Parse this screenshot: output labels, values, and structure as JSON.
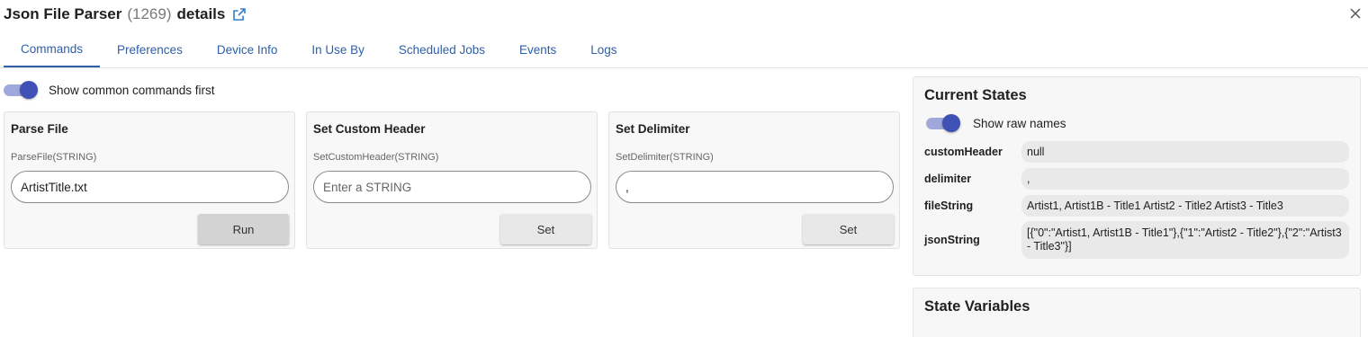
{
  "header": {
    "name": "Json File Parser",
    "id": "(1269)",
    "details": "details",
    "external_icon": "external-link-icon",
    "close_icon": "close-icon"
  },
  "tabs": [
    {
      "label": "Commands",
      "active": true
    },
    {
      "label": "Preferences",
      "active": false
    },
    {
      "label": "Device Info",
      "active": false
    },
    {
      "label": "In Use By",
      "active": false
    },
    {
      "label": "Scheduled Jobs",
      "active": false
    },
    {
      "label": "Events",
      "active": false
    },
    {
      "label": "Logs",
      "active": false
    }
  ],
  "commands": {
    "common_toggle_label": "Show common commands first",
    "common_toggle_on": true,
    "cards": [
      {
        "title": "Parse File",
        "signature": "ParseFile(STRING)",
        "value": "ArtistTitle.txt",
        "placeholder": "Enter a STRING",
        "button": "Run"
      },
      {
        "title": "Set Custom Header",
        "signature": "SetCustomHeader(STRING)",
        "value": "",
        "placeholder": "Enter a STRING",
        "button": "Set"
      },
      {
        "title": "Set Delimiter",
        "signature": "SetDelimiter(STRING)",
        "value": ",",
        "placeholder": "Enter a STRING",
        "button": "Set"
      }
    ]
  },
  "current_states": {
    "title": "Current States",
    "raw_names_label": "Show raw names",
    "raw_names_on": true,
    "rows": [
      {
        "key": "customHeader",
        "value": "null"
      },
      {
        "key": "delimiter",
        "value": ","
      },
      {
        "key": "fileString",
        "value": "Artist1, Artist1B - Title1 Artist2 - Title2 Artist3 - Title3"
      },
      {
        "key": "jsonString",
        "value": "[{\"0\":\"Artist1, Artist1B - Title1\"},{\"1\":\"Artist2 - Title2\"},{\"2\":\"Artist3 - Title3\"}]"
      }
    ]
  },
  "state_variables": {
    "title": "State Variables"
  },
  "colors": {
    "accent": "#3f51b5",
    "tab_text": "#2f5fa7",
    "track": "#9fa8da"
  }
}
